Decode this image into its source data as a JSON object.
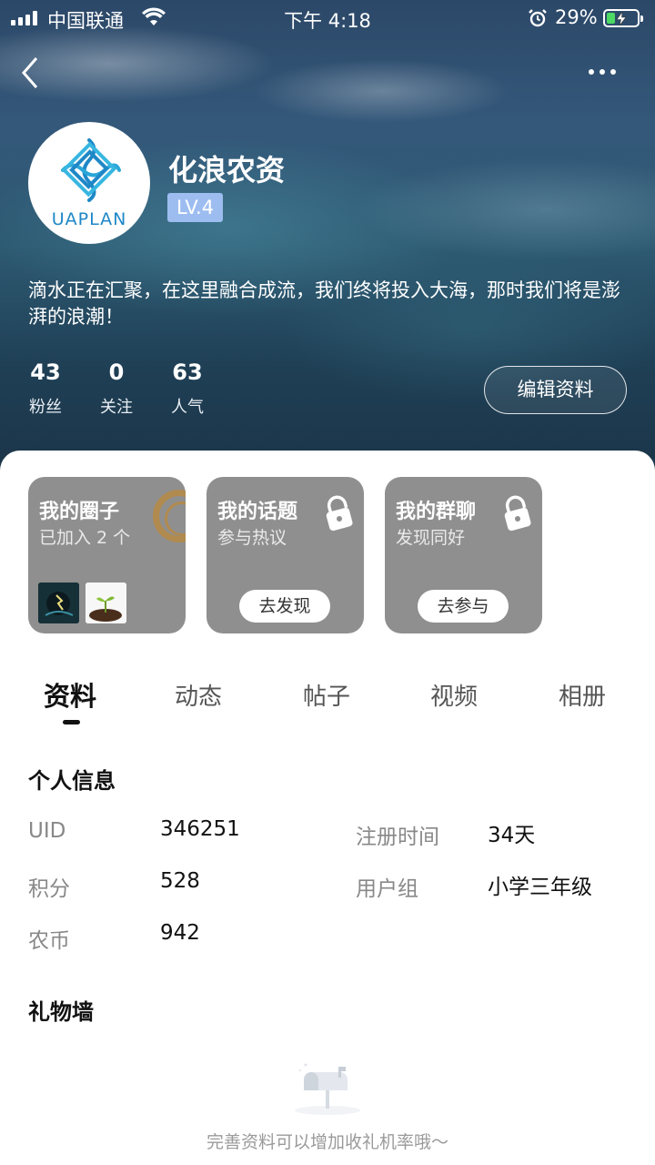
{
  "status_bar": {
    "carrier": "中国联通",
    "time": "下午 4:18",
    "battery_percent": "29%",
    "battery_level": 0.29
  },
  "profile": {
    "logo_text": "UAPLAN",
    "name": "化浪农资",
    "level": "LV.4",
    "bio": "滴水正在汇聚，在这里融合成流，我们终将投入大海，那时我们将是澎湃的浪潮！",
    "stats": [
      {
        "value": "43",
        "label": "粉丝"
      },
      {
        "value": "0",
        "label": "关注"
      },
      {
        "value": "63",
        "label": "人气"
      }
    ],
    "edit_label": "编辑资料"
  },
  "cards": [
    {
      "title": "我的圈子",
      "subtitle": "已加入 2 个"
    },
    {
      "title": "我的话题",
      "subtitle": "参与热议",
      "button": "去发现"
    },
    {
      "title": "我的群聊",
      "subtitle": "发现同好",
      "button": "去参与"
    }
  ],
  "tabs": [
    "资料",
    "动态",
    "帖子",
    "视频",
    "相册"
  ],
  "personal_info": {
    "title": "个人信息",
    "fields": [
      {
        "label": "UID",
        "value": "346251"
      },
      {
        "label": "注册时间",
        "value": "34天"
      },
      {
        "label": "积分",
        "value": "528"
      },
      {
        "label": "用户组",
        "value": "小学三年级"
      },
      {
        "label": "农币",
        "value": "942"
      }
    ]
  },
  "gift_wall": {
    "title": "礼物墙",
    "empty_hint": "完善资料可以增加收礼机率哦～"
  },
  "colors": {
    "level_badge": "#9dbdf0",
    "card_bg": "#8f8f8f",
    "logo_blue": "#1e88c7",
    "battery_green": "#4cd964"
  }
}
